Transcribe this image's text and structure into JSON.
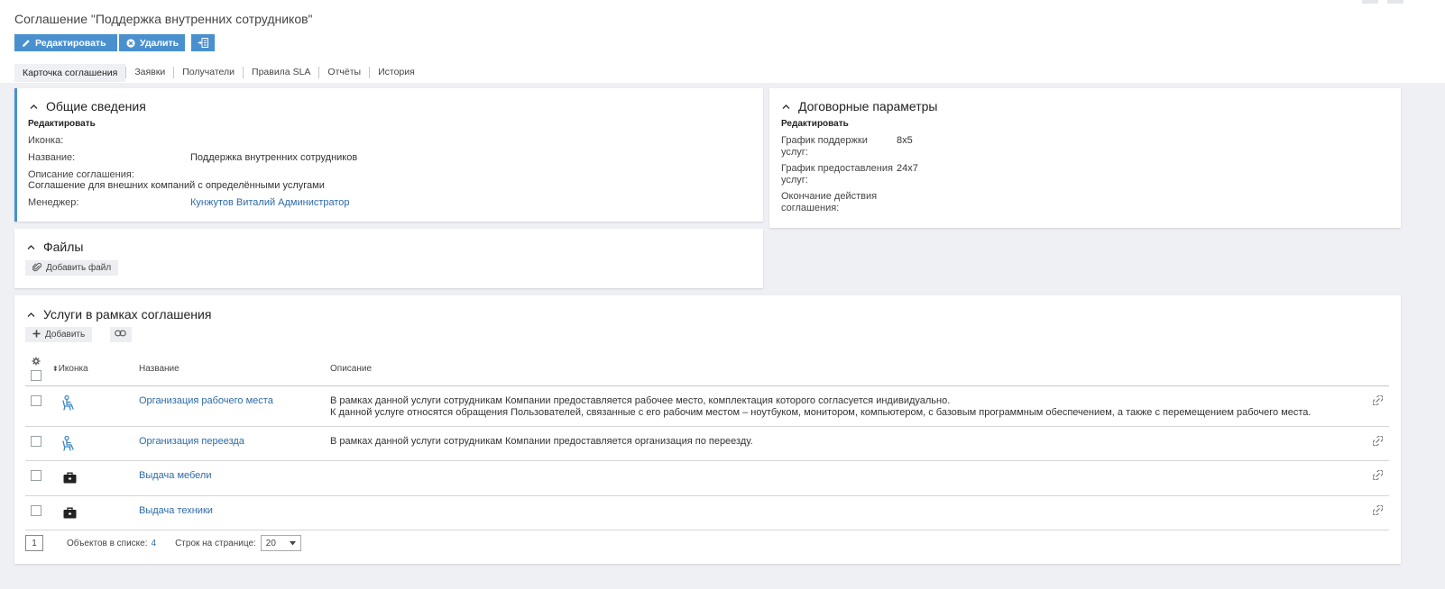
{
  "page": {
    "title": "Соглашение \"Поддержка внутренних сотрудников\""
  },
  "toolbar": {
    "edit_label": "Редактировать",
    "delete_label": "Удалить"
  },
  "tabs": [
    {
      "label": "Карточка соглашения"
    },
    {
      "label": "Заявки"
    },
    {
      "label": "Получатели"
    },
    {
      "label": "Правила SLA"
    },
    {
      "label": "Отчёты"
    },
    {
      "label": "История"
    }
  ],
  "general": {
    "title": "Общие сведения",
    "edit_label": "Редактировать",
    "icon_label": "Иконка:",
    "name_label": "Название:",
    "name_value": "Поддержка внутренних сотрудников",
    "description_label": "Описание соглашения:",
    "description_value": "Соглашение для внешних компаний с определёнными услугами",
    "manager_label": "Менеджер:",
    "manager_value": "Кунжутов Виталий Администратор"
  },
  "contract": {
    "title": "Договорные параметры",
    "edit_label": "Редактировать",
    "support_schedule_label_1": "График поддержки",
    "support_schedule_label_2": "услуг:",
    "support_schedule_value": "8x5",
    "provision_schedule_label_1": "График предоставления",
    "provision_schedule_label_2": "услуг:",
    "provision_schedule_value": "24x7",
    "end_label_1": "Окончание действия",
    "end_label_2": "соглашения:"
  },
  "files": {
    "title": "Файлы",
    "add_file_label": "Добавить файл"
  },
  "services": {
    "title": "Услуги в рамках соглашения",
    "add_label": "Добавить",
    "columns": {
      "icon": "Иконка",
      "name": "Название",
      "description": "Описание"
    },
    "rows": [
      {
        "icon": "chair-person-icon",
        "name": "Организация рабочего места",
        "description_1": "В рамках данной услуги сотрудникам Компании предоставляется рабочее место, комплектация которого согласуется индивидуально.",
        "description_2": "К данной услуге относятся обращения Пользователей, связанные с его рабочим местом – ноутбуком, монитором, компьютером, с базовым программным обеспечением, а также с перемещением рабочего места."
      },
      {
        "icon": "chair-person-icon",
        "name": "Организация переезда",
        "description_1": "В рамках данной услуги сотрудникам Компании предоставляется организация по переезду.",
        "description_2": ""
      },
      {
        "icon": "briefcase-icon",
        "name": "Выдача мебели",
        "description_1": "",
        "description_2": ""
      },
      {
        "icon": "briefcase-icon",
        "name": "Выдача техники",
        "description_1": "",
        "description_2": ""
      }
    ]
  },
  "pager": {
    "page": "1",
    "count_label": "Объектов в списке:",
    "count_value": "4",
    "rows_label": "Строк на странице:",
    "rows_value": "20"
  },
  "colors": {
    "accent": "#4a90cf",
    "link": "#2d6aa8",
    "background": "#eef0f4",
    "active_border": "#4a90cf"
  }
}
